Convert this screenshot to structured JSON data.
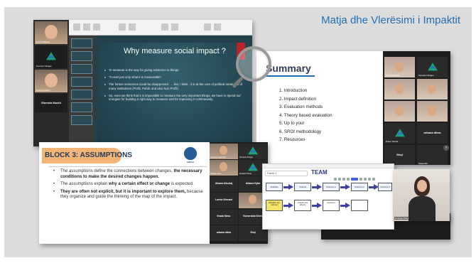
{
  "slide": {
    "title": "Matja dhe Vlerësimi i Impaktit"
  },
  "window1": {
    "slide_title": "Why measure social impact ?",
    "bullets": [
      "To measure is the way for giving existence to things.",
      "\"It exist just only what it is measurable\".",
      "The former sentences could be disapproved …. but, I think , it is at the core of political strategies of many institutions (Profit, Public and also Non Profit)",
      "So, even we think that it is impossible to measure the very important things, we have to spend our energies for building a right way to measure and for improving it continuously."
    ],
    "participants": [
      "Enrico Maestri",
      "Pensioni Shqipe",
      "Emirjeta Shopi",
      "Shenela Mushi"
    ]
  },
  "window2": {
    "title": "Summary",
    "items": [
      "1.   Introduction",
      "2.   Impact definition",
      "3.   Evaluation methods",
      "4.   Theory based evaluation",
      "5.   Up to you!",
      "6.   SROI methodology",
      "7.   Resources"
    ],
    "participants": [
      "Enrico Maestri",
      "Pensioni Shqipe",
      "",
      "",
      "",
      "",
      "Rakel Teleda",
      "arbana dibra",
      "Shqi",
      "Saida Brit"
    ]
  },
  "window3": {
    "title": "BLOCK 3: ASSUMPTIONS",
    "logo_text": "ARDHJA",
    "bullets": [
      {
        "pre": "The assumptions define the connections between changes, ",
        "bold": "the necessary conditions to make the desired changes happen.",
        "post": ""
      },
      {
        "pre": "The assumptions explain ",
        "bold": "why a certain effect or change",
        "post": " is expected."
      },
      {
        "pre": "",
        "bold": "They are often not explicit, but it is important to explore them,",
        "post": " because they organize and guide the thinking of the map of the impact."
      }
    ],
    "participants": [
      "Gabriela Gashollari",
      "Pensioni Shqipe",
      "Shqipe Gjoni",
      "Emirjeta Shopi",
      "Albana Aliustaj",
      "Aldana Hyka",
      "Loreta Shenazi",
      "",
      "Erada Meso",
      "Esmeralda Shehi",
      "arbana dibra",
      "Shqi"
    ]
  },
  "window4": {
    "title": "TEAM",
    "toolbar": "Frame 1",
    "nodes": [
      "Activities",
      "Outputs",
      "Outcome 1",
      "Outcome 2",
      "Outcome 3",
      "Activities are defined",
      "Outputs are effects",
      "Outcome",
      ""
    ]
  },
  "window5": {
    "participant": "Emirjeta Shopi"
  }
}
